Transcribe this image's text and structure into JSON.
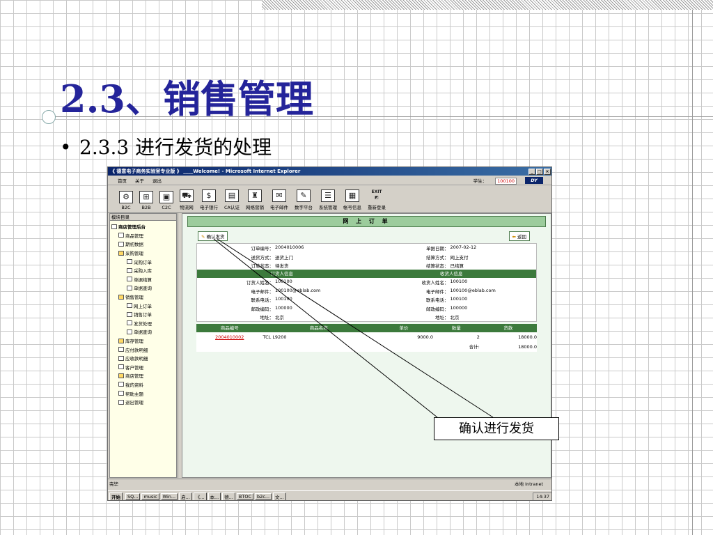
{
  "slide": {
    "title": "2.3、销售管理",
    "bullet": "2.3.3 进行发货的处理",
    "callout": "确认进行发货"
  },
  "window": {
    "title": "《 德意电子商务实验室专业版 》 ____Welcome! - Microsoft Internet Explorer",
    "menu": [
      "首页",
      "关于",
      "退出"
    ],
    "student_label": "学生：",
    "student_id": "100100",
    "toolbar": [
      {
        "label": "B2C",
        "icon": "b2c-icon"
      },
      {
        "label": "B2B",
        "icon": "b2b-icon"
      },
      {
        "label": "C2C",
        "icon": "c2c-icon"
      },
      {
        "label": "物流网",
        "icon": "logistics-icon"
      },
      {
        "label": "电子银行",
        "icon": "bank-icon"
      },
      {
        "label": "CA认证",
        "icon": "ca-icon"
      },
      {
        "label": "网络营销",
        "icon": "marketing-icon"
      },
      {
        "label": "电子邮件",
        "icon": "email-icon"
      },
      {
        "label": "数字平台",
        "icon": "digital-icon"
      },
      {
        "label": "系统管理",
        "icon": "system-icon"
      },
      {
        "label": "帐号信息",
        "icon": "account-icon"
      },
      {
        "label": "重新登录",
        "icon": "exit-icon",
        "caption": "EXIT"
      }
    ],
    "sidebar": {
      "header": "模块目录",
      "items": [
        {
          "label": "商店管理后台",
          "level": 0
        },
        {
          "label": "商品管理",
          "level": 1
        },
        {
          "label": "期初数据",
          "level": 1
        },
        {
          "label": "采购管理",
          "level": 1,
          "folder": true
        },
        {
          "label": "采购订单",
          "level": 2
        },
        {
          "label": "采购入库",
          "level": 2
        },
        {
          "label": "单据结算",
          "level": 2
        },
        {
          "label": "单据查询",
          "level": 2
        },
        {
          "label": "销售管理",
          "level": 1,
          "folder": true
        },
        {
          "label": "网上订单",
          "level": 2
        },
        {
          "label": "销售订单",
          "level": 2
        },
        {
          "label": "发货处理",
          "level": 2
        },
        {
          "label": "单据查询",
          "level": 2
        },
        {
          "label": "库存管理",
          "level": 1,
          "folder": true
        },
        {
          "label": "应付款明细",
          "level": 1
        },
        {
          "label": "应收款明细",
          "level": 1
        },
        {
          "label": "客户管理",
          "level": 1
        },
        {
          "label": "商店管理",
          "level": 1,
          "folder": true
        },
        {
          "label": "我的资料",
          "level": 1
        },
        {
          "label": "帮助主题",
          "level": 1
        },
        {
          "label": "退出管理",
          "level": 1
        }
      ]
    },
    "main": {
      "banner": "网 上 订 单",
      "confirm_button": "确认发货",
      "back_button": "返回",
      "order_rows": [
        {
          "l1": "订单编号：",
          "v1": "2004010006",
          "l2": "单据日期：",
          "v2": "2007-02-12"
        },
        {
          "l1": "送货方式：",
          "v1": "送货上门",
          "l2": "结算方式：",
          "v2": "网上支付"
        },
        {
          "l1": "订单状态：",
          "v1": "待发货",
          "l2": "结算状态：",
          "v2": "已结算"
        }
      ],
      "orderer_header": "订货人信息",
      "receiver_header": "收货人信息",
      "person_rows": [
        {
          "l1": "订货人姓名：",
          "v1": "100100",
          "l2": "收货人姓名：",
          "v2": "100100"
        },
        {
          "l1": "电子邮件：",
          "v1": "100100@eblab.com",
          "l2": "电子邮件：",
          "v2": "100100@eblab.com"
        },
        {
          "l1": "联系电话：",
          "v1": "100100",
          "l2": "联系电话：",
          "v2": "100100"
        },
        {
          "l1": "邮政编码：",
          "v1": "100000",
          "l2": "邮政编码：",
          "v2": "100000"
        },
        {
          "l1": "地址：",
          "v1": "北京",
          "l2": "地址：",
          "v2": "北京"
        }
      ],
      "item_headers": [
        "商品编号",
        "商品名称",
        "单价",
        "数量",
        "货款"
      ],
      "items": [
        {
          "code": "2004010002",
          "name": "TCL L9200",
          "price": "9000.0",
          "qty": "2",
          "amount": "18000.0"
        }
      ],
      "total_label": "合计:",
      "total_value": "18000.0"
    },
    "status": {
      "text": "完毕",
      "zone": "本地 Intranet"
    },
    "taskbar": {
      "start": "开始",
      "tasks": [
        "SQ...",
        "music",
        "Win...",
        "启...",
        "《...",
        "本...",
        "德...",
        "BTOC",
        "b2c...",
        "文..."
      ],
      "clock": "14:37"
    }
  }
}
